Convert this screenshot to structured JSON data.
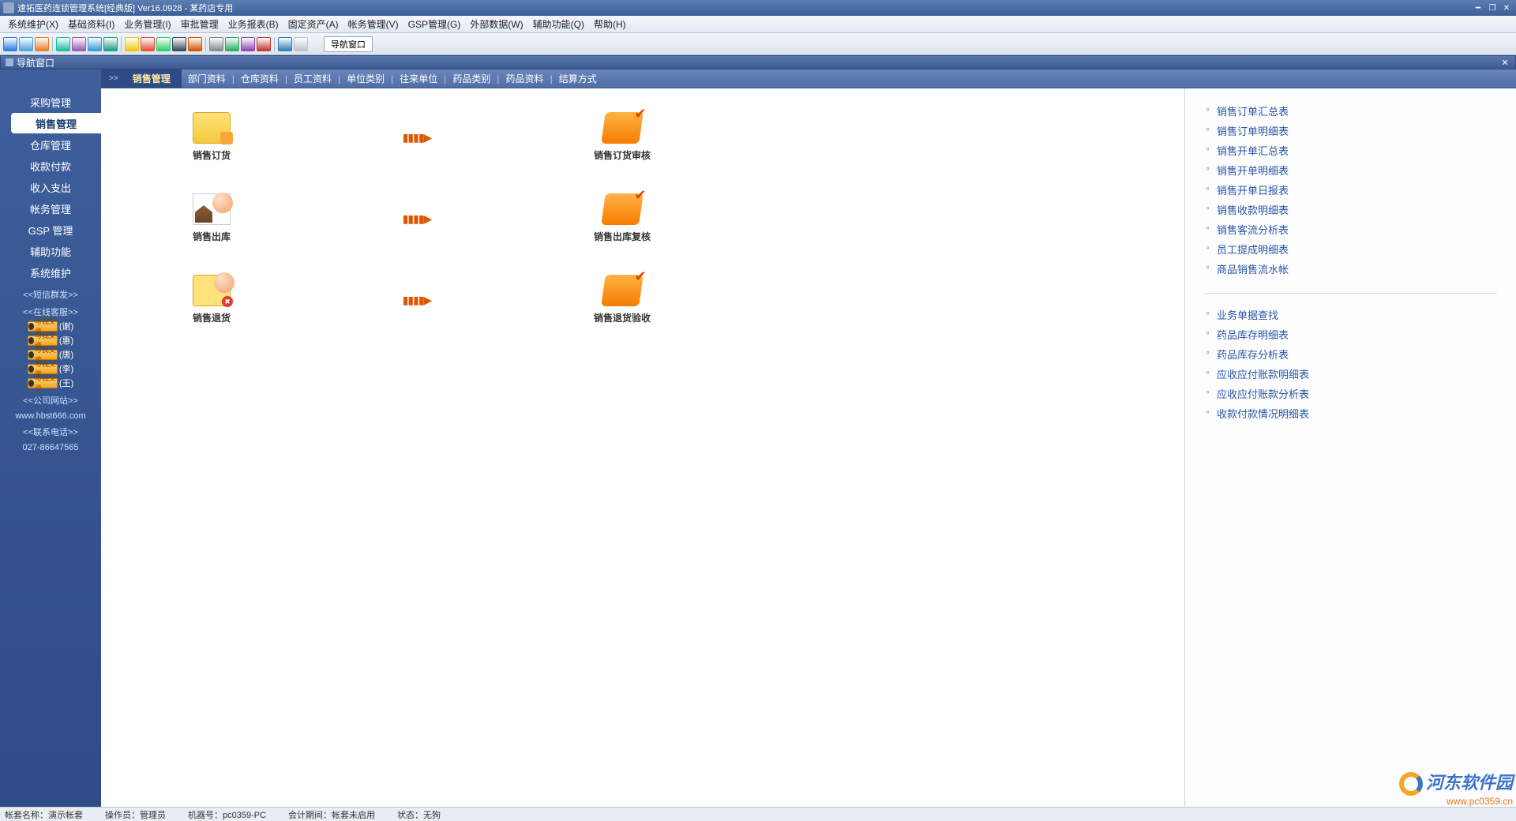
{
  "titlebar": {
    "title": "速拓医药连锁管理系统[经典版] Ver16.0928  -  某药店专用"
  },
  "menubar": [
    "系统维护(X)",
    "基础资料(I)",
    "业务管理(I)",
    "审批管理",
    "业务报表(B)",
    "固定资产(A)",
    "帐务管理(V)",
    "GSP管理(G)",
    "外部数据(W)",
    "辅助功能(Q)",
    "帮助(H)"
  ],
  "toolbar": {
    "navbtn": "导航窗口"
  },
  "navwin": {
    "title": "导航窗口"
  },
  "sidebar": {
    "items": [
      "采购管理",
      "销售管理",
      "仓库管理",
      "收款付款",
      "收入支出",
      "帐务管理",
      "GSP 管理",
      "辅助功能",
      "系统维护"
    ],
    "activeIndex": 1,
    "links": {
      "sms": "<<短信群发>>",
      "online": "<<在线客服>>",
      "badge": "与我交谈",
      "contacts": [
        "(谢)",
        "(惠)",
        "(唐)",
        "(李)",
        "(王)"
      ],
      "site_label": "<<公司网站>>",
      "site": "www.hbst666.com",
      "tel_label": "<<联系电话>>",
      "tel": "027-86647565"
    }
  },
  "breadcrumb": {
    "arrow": ">>",
    "current": "销售管理",
    "links": [
      "部门资料",
      "仓库资料",
      "员工资料",
      "单位类别",
      "往来单位",
      "药品类别",
      "药品资料",
      "结算方式"
    ]
  },
  "flow": {
    "rows": [
      {
        "left": "销售订货",
        "right": "销售订货审核"
      },
      {
        "left": "销售出库",
        "right": "销售出库复核"
      },
      {
        "left": "销售退货",
        "right": "销售退货验收"
      }
    ]
  },
  "rightpanel": {
    "group1": [
      "销售订单汇总表",
      "销售订单明细表",
      "销售开单汇总表",
      "销售开单明细表",
      "销售开单日报表",
      "销售收款明细表",
      "销售客流分析表",
      "员工提成明细表",
      "商品销售流水帐"
    ],
    "group2": [
      "业务单据查找",
      "药品库存明细表",
      "药品库存分析表",
      "应收应付账款明细表",
      "应收应付账款分析表",
      "收款付款情况明细表"
    ]
  },
  "statusbar": {
    "s1l": "帐套名称：",
    "s1v": "演示帐套",
    "s2l": "操作员：",
    "s2v": "管理员",
    "s3l": "机器号：",
    "s3v": "pc0359-PC",
    "s4l": "会计期间：",
    "s4v": "帐套未启用",
    "s5l": "状态：",
    "s5v": "无狗"
  },
  "watermark": {
    "line1": "河东软件园",
    "line2": "www.pc0359.cn"
  },
  "colors": {
    "tb": [
      "#2c7be5",
      "#4aa3df",
      "#e67e22",
      "#1abc9c",
      "#9b59b6",
      "#3498db",
      "#16a085",
      "#f1c40f",
      "#e74c3c",
      "#2ecc71",
      "#34495e",
      "#d35400",
      "#7f8c8d",
      "#27ae60",
      "#8e44ad",
      "#c0392b",
      "#2980b9",
      "#bdc3c7"
    ]
  }
}
